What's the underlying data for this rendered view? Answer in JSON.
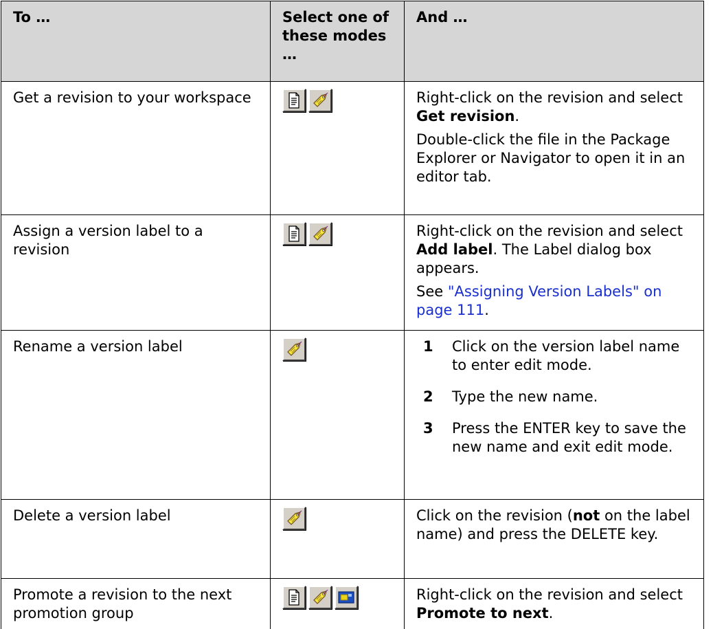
{
  "table": {
    "headers": {
      "col1": "To …",
      "col2": "Select one of these modes …",
      "col3": "And …"
    },
    "rows": [
      {
        "task": "Get a revision to your workspace",
        "modes": [
          "file-revision-mode-icon",
          "version-label-mode-icon"
        ],
        "p1_pre": "Right-click on the revision and select ",
        "p1_bold": "Get revision",
        "p1_post": ".",
        "p2": "Double-click the file in the Package Explorer or Navigator to open it in an editor tab."
      },
      {
        "task": "Assign a version label to a revision",
        "modes": [
          "file-revision-mode-icon",
          "version-label-mode-icon"
        ],
        "p1_pre": "Right-click on the revision and select ",
        "p1_bold": "Add label",
        "p1_post": ". The Label dialog box appears.",
        "p2_pre": "See ",
        "p2_link": "\"Assigning Version Labels\" on page 111",
        "p2_post": "."
      },
      {
        "task": "Rename a version label",
        "modes": [
          "version-label-mode-icon"
        ],
        "steps": [
          {
            "num": "1",
            "text": "Click on the version label name to enter edit mode."
          },
          {
            "num": "2",
            "text": "Type the new name."
          },
          {
            "num": "3",
            "text": "Press the ENTER key to save the new name and exit edit mode."
          }
        ]
      },
      {
        "task": "Delete a version label",
        "modes": [
          "version-label-mode-icon"
        ],
        "p1_pre": "Click on the revision (",
        "p1_bold": "not",
        "p1_post": " on the label name) and press the DELETE key."
      },
      {
        "task": "Promote a revision to the next promotion group",
        "modes": [
          "file-revision-mode-icon",
          "version-label-mode-icon",
          "promotion-state-mode-icon"
        ],
        "p1_pre": "Right-click on the revision and select ",
        "p1_bold": "Promote to next",
        "p1_post": "."
      }
    ]
  },
  "colors": {
    "header_bg": "#d6d6d6",
    "link": "#1a2fcf",
    "tag_yellow": "#f4e83a",
    "tag_outline": "#7a5a2a"
  }
}
